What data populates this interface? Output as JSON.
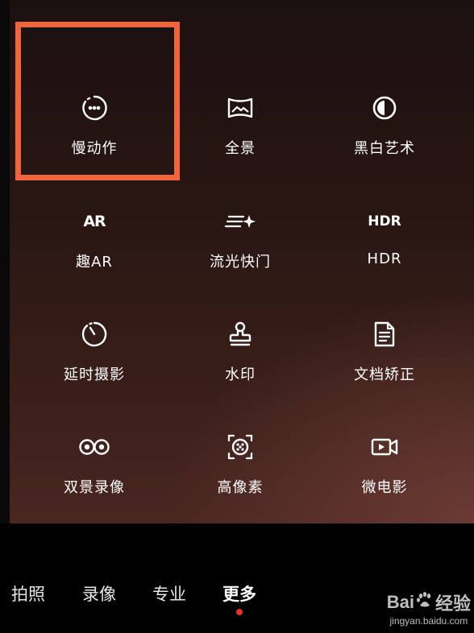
{
  "grid": [
    {
      "label": "慢动作",
      "icon": "slow-motion-icon"
    },
    {
      "label": "全景",
      "icon": "panorama-icon"
    },
    {
      "label": "黑白艺术",
      "icon": "mono-art-icon"
    },
    {
      "label": "趣AR",
      "icon": "ar-icon",
      "icon_text": "AR"
    },
    {
      "label": "流光快门",
      "icon": "light-trail-icon"
    },
    {
      "label": "HDR",
      "icon": "hdr-icon",
      "icon_text": "HDR"
    },
    {
      "label": "延时摄影",
      "icon": "time-lapse-icon"
    },
    {
      "label": "水印",
      "icon": "watermark-stamp-icon"
    },
    {
      "label": "文档矫正",
      "icon": "document-correct-icon"
    },
    {
      "label": "双景录像",
      "icon": "dual-view-icon"
    },
    {
      "label": "高像素",
      "icon": "high-resolution-icon"
    },
    {
      "label": "微电影",
      "icon": "micro-movie-icon"
    }
  ],
  "modes": [
    "拍照",
    "录像",
    "专业",
    "更多"
  ],
  "active_mode": "更多",
  "highlight_color": "#f0653c",
  "active_dot_color": "#e3342f",
  "watermark": {
    "brand": "Bai",
    "suffix": "经验",
    "url": "jingyan.baidu.com"
  }
}
